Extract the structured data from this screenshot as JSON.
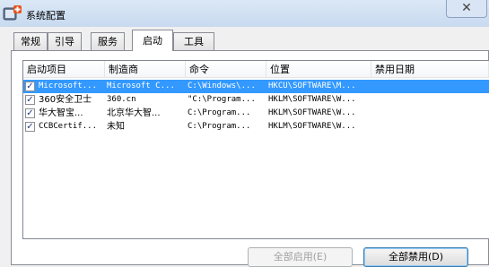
{
  "window": {
    "title": "系统配置",
    "close_glyph": "✕"
  },
  "tabs": [
    {
      "label": "常规",
      "active": false
    },
    {
      "label": "引导",
      "active": false
    },
    {
      "label": "服务",
      "active": false
    },
    {
      "label": "启动",
      "active": true
    },
    {
      "label": "工具",
      "active": false
    }
  ],
  "columns": [
    "启动项目",
    "制造商",
    "命令",
    "位置",
    "禁用日期"
  ],
  "rows": [
    {
      "checked": true,
      "selected": true,
      "item": "Microsoft...",
      "maker": "Microsoft C...",
      "command": "C:\\Windows\\...",
      "location": "HKCU\\SOFTWARE\\M...",
      "disabled_date": ""
    },
    {
      "checked": true,
      "selected": false,
      "item": "360安全卫士",
      "maker": "360.cn",
      "command": "\"C:\\Program...",
      "location": "HKLM\\SOFTWARE\\W...",
      "disabled_date": ""
    },
    {
      "checked": true,
      "selected": false,
      "item": "华大智宝...",
      "maker": "北京华大智...",
      "command": "C:\\Program...",
      "location": "HKLM\\SOFTWARE\\W...",
      "disabled_date": ""
    },
    {
      "checked": true,
      "selected": false,
      "item": "CCBCertif...",
      "maker": "未知",
      "command": "C:\\Program...",
      "location": "HKLM\\SOFTWARE\\W...",
      "disabled_date": ""
    }
  ],
  "buttons": {
    "enable_all": "全部启用(E)",
    "disable_all": "全部禁用(D)"
  },
  "colors": {
    "selection": "#3399ff",
    "title_bar": "#c8daf0",
    "disabled_text": "#a0a0a0"
  },
  "icons": {
    "app": "msconfig-icon",
    "checkbox": "checkmark-icon"
  }
}
